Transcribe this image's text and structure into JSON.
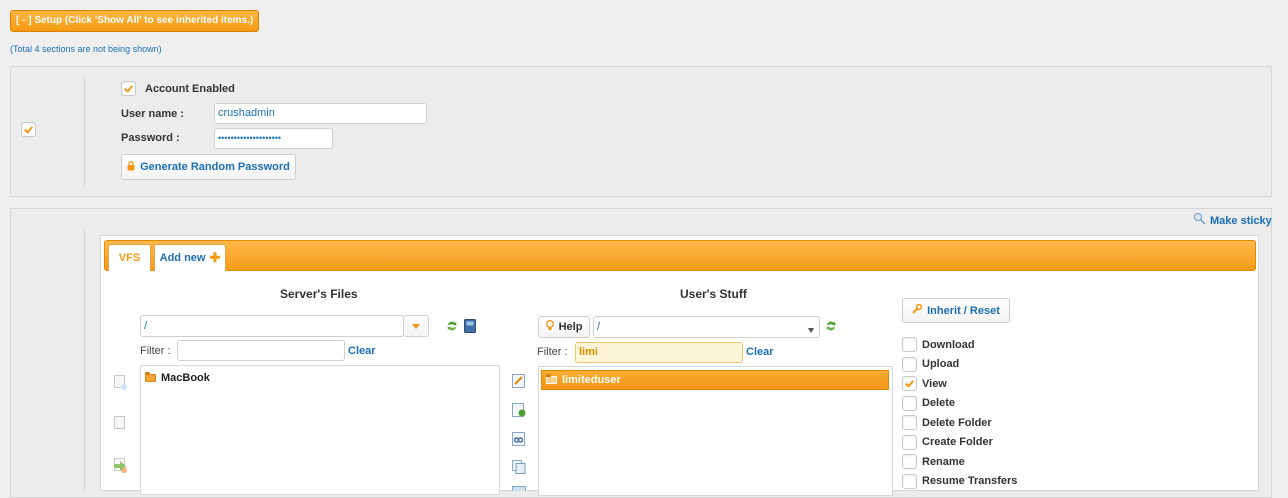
{
  "setup": {
    "header": "[ - ] Setup (Click 'Show All' to see inherited items.)",
    "total_note": "(Total 4 sections are not being shown)"
  },
  "account": {
    "enabled_label": "Account Enabled",
    "enabled_checked": true,
    "section_checked": true,
    "username_label": "User name :",
    "username_value": "crushadmin",
    "password_label": "Password :",
    "password_value": "••••••••••••••••••••",
    "generate_label": "Generate Random Password"
  },
  "make_sticky": "Make sticky",
  "tabs": [
    {
      "label": "VFS"
    },
    {
      "label": "Add new"
    }
  ],
  "server_files": {
    "title": "Server's Files",
    "path_value": "/",
    "filter_label": "Filter :",
    "filter_value": "",
    "clear_label": "Clear",
    "items": [
      "MacBook"
    ]
  },
  "user_stuff": {
    "title": "User's Stuff",
    "help_label": "Help",
    "path_value": "/",
    "filter_label": "Filter :",
    "filter_value": "limi",
    "clear_label": "Clear",
    "items": [
      "limiteduser"
    ]
  },
  "permissions": {
    "inherit_label": "Inherit / Reset",
    "items": [
      {
        "label": "Download",
        "checked": false
      },
      {
        "label": "Upload",
        "checked": false
      },
      {
        "label": "View",
        "checked": true
      },
      {
        "label": "Delete",
        "checked": false
      },
      {
        "label": "Delete Folder",
        "checked": false
      },
      {
        "label": "Create Folder",
        "checked": false
      },
      {
        "label": "Rename",
        "checked": false
      },
      {
        "label": "Resume Transfers",
        "checked": false
      }
    ]
  },
  "colors": {
    "accent": "#f39c18",
    "link": "#1a6fb5",
    "selected_row": "#f5a020"
  }
}
